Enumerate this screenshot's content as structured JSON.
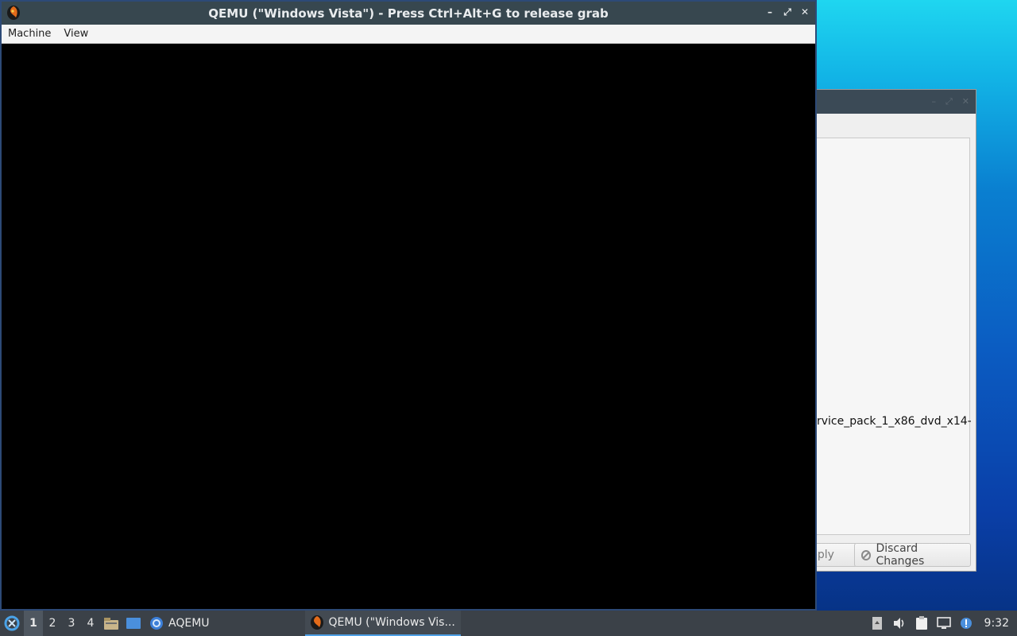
{
  "qemu_window": {
    "title": "QEMU (\"Windows Vista\") - Press Ctrl+Alt+G to release grab",
    "menu": [
      "Machine",
      "View"
    ],
    "controls": [
      "minimize-icon",
      "restore-icon",
      "close-icon"
    ]
  },
  "background_window": {
    "path_text": "rvice_pack_1_x86_dvd_x14-",
    "apply_label": "pply",
    "discard_label": "Discard Changes"
  },
  "taskbar": {
    "workspaces": [
      "1",
      "2",
      "3",
      "4"
    ],
    "active_workspace": "1",
    "tasks": [
      {
        "label": "AQEMU",
        "icon": "aqemu-icon"
      },
      {
        "label": "QEMU (\"Windows Vis...",
        "icon": "qemu-icon"
      }
    ],
    "clock": "9:32"
  },
  "colors": {
    "titlebar": "#37474f",
    "taskbar": "#3b4148",
    "accent": "#4ea0e6"
  }
}
